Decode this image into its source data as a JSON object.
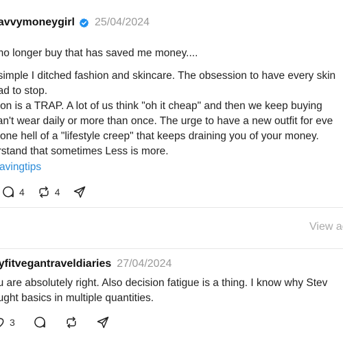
{
  "post": {
    "username": "savvymoneygirl",
    "date": "25/04/2024",
    "lines": [
      "I no longer buy that has saved me money....",
      "",
      "t simple I ditched fashion and skincare. The obsession to have every skin",
      " had to stop.",
      "hion is a TRAP. A lot of us think \"oh it cheap\" and then we keep buying",
      "can't wear daily or more than once. The urge to have a new outfit for eve",
      "s one hell of a \"lifestyle creep\" that keeps draining you of your money.",
      "erstand that sometimes Less is more."
    ],
    "hashtag": "avingtips",
    "comment_count": "4",
    "repost_count": "4"
  },
  "view_link": "View ac",
  "reply": {
    "username": "nyfitvegantraveldiaries",
    "date": "27/04/2024",
    "lines": [
      "ou are absolutely right. Also decision fatigue is a thing. I know why Stev",
      "ought basics in multiple quantities."
    ],
    "like_count": "3"
  },
  "colors": {
    "accent": "#2a8bd8",
    "muted": "#999999",
    "verified": "#1d8ff0"
  },
  "icons": [
    "verified-icon",
    "comment-icon",
    "repost-icon",
    "share-icon",
    "like-icon"
  ]
}
